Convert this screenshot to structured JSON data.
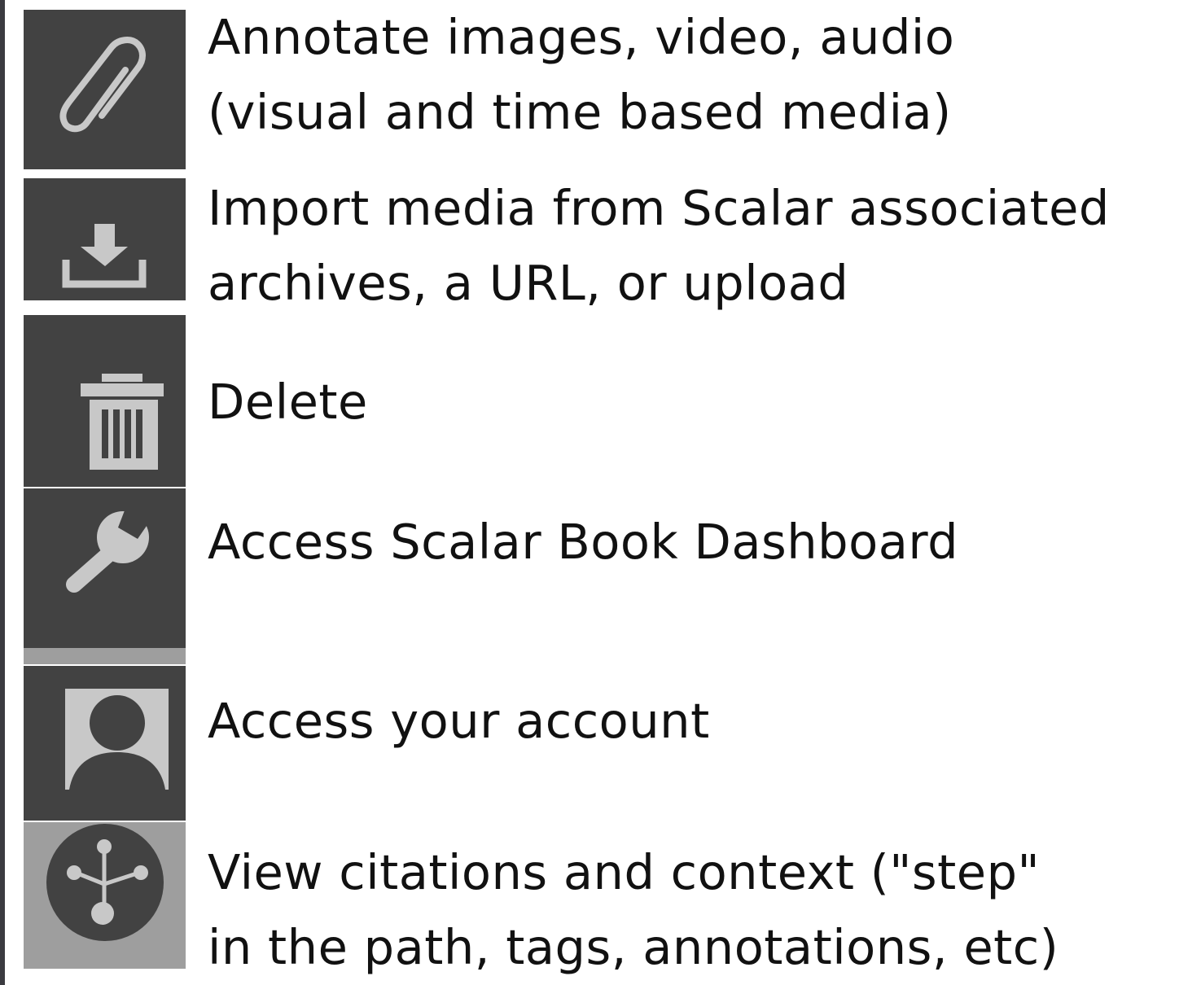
{
  "colors": {
    "tile_dark": "#424242",
    "tile_light": "#9e9e9e",
    "icon_fill": "#c8c8c8",
    "text": "#111111"
  },
  "legend": [
    {
      "icon": "paperclip-icon",
      "lines": [
        "Annotate images, video, audio",
        "(visual and time based media)"
      ]
    },
    {
      "icon": "import-download-icon",
      "lines": [
        "Import media from Scalar associated",
        "archives, a URL, or upload"
      ]
    },
    {
      "icon": "trash-icon",
      "lines": [
        "Delete"
      ]
    },
    {
      "icon": "wrench-icon",
      "lines": [
        "Access Scalar Book Dashboard"
      ]
    },
    {
      "icon": "user-account-icon",
      "lines": [
        "Access your account"
      ]
    },
    {
      "icon": "citations-network-icon",
      "lines": [
        "View citations and context (\"step\"",
        "in the path, tags, annotations, etc)"
      ]
    }
  ]
}
